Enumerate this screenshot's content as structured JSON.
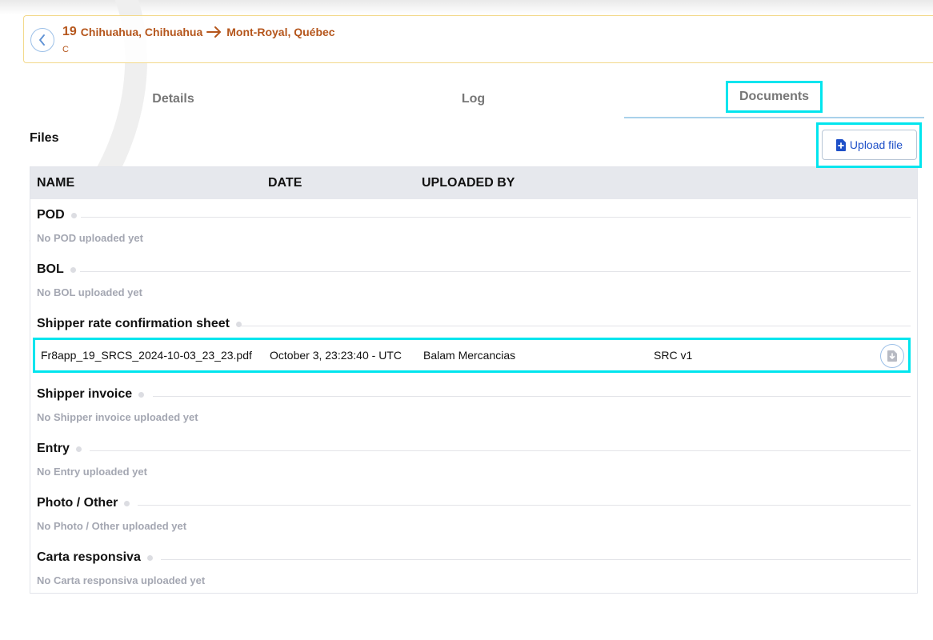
{
  "header": {
    "load_number": "19",
    "origin": "Chihuahua, Chihuahua",
    "destination": "Mont-Royal, Québec",
    "sub_label": "C"
  },
  "tabs": [
    {
      "label": "Details"
    },
    {
      "label": "Log"
    },
    {
      "label": "Documents"
    }
  ],
  "active_tab": "Documents",
  "files": {
    "title": "Files",
    "upload_label": "Upload file",
    "columns": [
      "NAME",
      "DATE",
      "UPLOADED BY"
    ],
    "groups": [
      {
        "title": "POD",
        "empty_text": "No POD uploaded yet"
      },
      {
        "title": "BOL",
        "empty_text": "No BOL uploaded yet"
      },
      {
        "title": "Shipper rate confirmation sheet",
        "file": {
          "name": "Fr8app_19_SRCS_2024-10-03_23_23.pdf",
          "date": "October 3, 23:23:40 - UTC",
          "uploaded_by": "Balam Mercancias",
          "version": "SRC v1"
        }
      },
      {
        "title": "Shipper invoice",
        "empty_text": "No Shipper invoice uploaded yet"
      },
      {
        "title": "Entry",
        "empty_text": "No Entry uploaded yet"
      },
      {
        "title": "Photo / Other",
        "empty_text": "No Photo / Other uploaded yet"
      },
      {
        "title": "Carta responsiva",
        "empty_text": "No Carta responsiva uploaded yet"
      }
    ]
  },
  "colors": {
    "route": "#b5561c",
    "accent_blue": "#1e50c8",
    "highlight": "#00e5ee",
    "muted_text": "#a4a7b2"
  },
  "icons": {
    "back": "chevron-left-icon",
    "route_arrow": "arrow-right-icon",
    "upload": "file-plus-icon",
    "download": "download-icon"
  }
}
